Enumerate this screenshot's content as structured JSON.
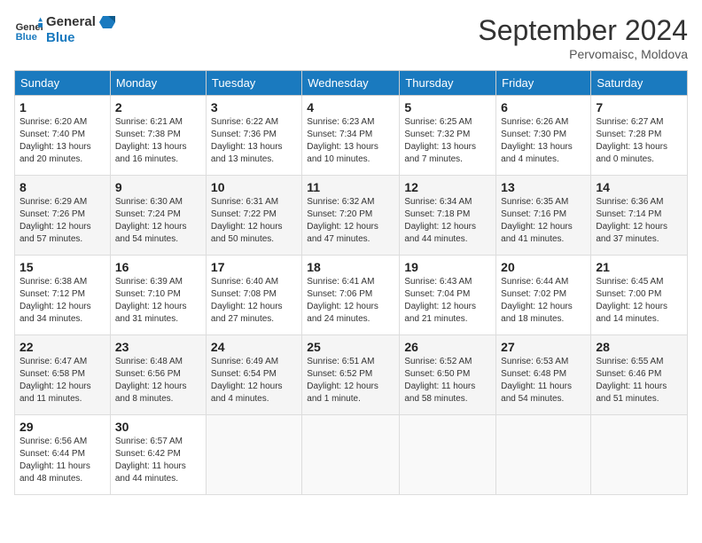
{
  "header": {
    "logo_general": "General",
    "logo_blue": "Blue",
    "month_title": "September 2024",
    "location": "Pervomaisc, Moldova"
  },
  "weekdays": [
    "Sunday",
    "Monday",
    "Tuesday",
    "Wednesday",
    "Thursday",
    "Friday",
    "Saturday"
  ],
  "weeks": [
    [
      {
        "day": "1",
        "info": "Sunrise: 6:20 AM\nSunset: 7:40 PM\nDaylight: 13 hours\nand 20 minutes."
      },
      {
        "day": "2",
        "info": "Sunrise: 6:21 AM\nSunset: 7:38 PM\nDaylight: 13 hours\nand 16 minutes."
      },
      {
        "day": "3",
        "info": "Sunrise: 6:22 AM\nSunset: 7:36 PM\nDaylight: 13 hours\nand 13 minutes."
      },
      {
        "day": "4",
        "info": "Sunrise: 6:23 AM\nSunset: 7:34 PM\nDaylight: 13 hours\nand 10 minutes."
      },
      {
        "day": "5",
        "info": "Sunrise: 6:25 AM\nSunset: 7:32 PM\nDaylight: 13 hours\nand 7 minutes."
      },
      {
        "day": "6",
        "info": "Sunrise: 6:26 AM\nSunset: 7:30 PM\nDaylight: 13 hours\nand 4 minutes."
      },
      {
        "day": "7",
        "info": "Sunrise: 6:27 AM\nSunset: 7:28 PM\nDaylight: 13 hours\nand 0 minutes."
      }
    ],
    [
      {
        "day": "8",
        "info": "Sunrise: 6:29 AM\nSunset: 7:26 PM\nDaylight: 12 hours\nand 57 minutes."
      },
      {
        "day": "9",
        "info": "Sunrise: 6:30 AM\nSunset: 7:24 PM\nDaylight: 12 hours\nand 54 minutes."
      },
      {
        "day": "10",
        "info": "Sunrise: 6:31 AM\nSunset: 7:22 PM\nDaylight: 12 hours\nand 50 minutes."
      },
      {
        "day": "11",
        "info": "Sunrise: 6:32 AM\nSunset: 7:20 PM\nDaylight: 12 hours\nand 47 minutes."
      },
      {
        "day": "12",
        "info": "Sunrise: 6:34 AM\nSunset: 7:18 PM\nDaylight: 12 hours\nand 44 minutes."
      },
      {
        "day": "13",
        "info": "Sunrise: 6:35 AM\nSunset: 7:16 PM\nDaylight: 12 hours\nand 41 minutes."
      },
      {
        "day": "14",
        "info": "Sunrise: 6:36 AM\nSunset: 7:14 PM\nDaylight: 12 hours\nand 37 minutes."
      }
    ],
    [
      {
        "day": "15",
        "info": "Sunrise: 6:38 AM\nSunset: 7:12 PM\nDaylight: 12 hours\nand 34 minutes."
      },
      {
        "day": "16",
        "info": "Sunrise: 6:39 AM\nSunset: 7:10 PM\nDaylight: 12 hours\nand 31 minutes."
      },
      {
        "day": "17",
        "info": "Sunrise: 6:40 AM\nSunset: 7:08 PM\nDaylight: 12 hours\nand 27 minutes."
      },
      {
        "day": "18",
        "info": "Sunrise: 6:41 AM\nSunset: 7:06 PM\nDaylight: 12 hours\nand 24 minutes."
      },
      {
        "day": "19",
        "info": "Sunrise: 6:43 AM\nSunset: 7:04 PM\nDaylight: 12 hours\nand 21 minutes."
      },
      {
        "day": "20",
        "info": "Sunrise: 6:44 AM\nSunset: 7:02 PM\nDaylight: 12 hours\nand 18 minutes."
      },
      {
        "day": "21",
        "info": "Sunrise: 6:45 AM\nSunset: 7:00 PM\nDaylight: 12 hours\nand 14 minutes."
      }
    ],
    [
      {
        "day": "22",
        "info": "Sunrise: 6:47 AM\nSunset: 6:58 PM\nDaylight: 12 hours\nand 11 minutes."
      },
      {
        "day": "23",
        "info": "Sunrise: 6:48 AM\nSunset: 6:56 PM\nDaylight: 12 hours\nand 8 minutes."
      },
      {
        "day": "24",
        "info": "Sunrise: 6:49 AM\nSunset: 6:54 PM\nDaylight: 12 hours\nand 4 minutes."
      },
      {
        "day": "25",
        "info": "Sunrise: 6:51 AM\nSunset: 6:52 PM\nDaylight: 12 hours\nand 1 minute."
      },
      {
        "day": "26",
        "info": "Sunrise: 6:52 AM\nSunset: 6:50 PM\nDaylight: 11 hours\nand 58 minutes."
      },
      {
        "day": "27",
        "info": "Sunrise: 6:53 AM\nSunset: 6:48 PM\nDaylight: 11 hours\nand 54 minutes."
      },
      {
        "day": "28",
        "info": "Sunrise: 6:55 AM\nSunset: 6:46 PM\nDaylight: 11 hours\nand 51 minutes."
      }
    ],
    [
      {
        "day": "29",
        "info": "Sunrise: 6:56 AM\nSunset: 6:44 PM\nDaylight: 11 hours\nand 48 minutes."
      },
      {
        "day": "30",
        "info": "Sunrise: 6:57 AM\nSunset: 6:42 PM\nDaylight: 11 hours\nand 44 minutes."
      },
      {
        "day": "",
        "info": ""
      },
      {
        "day": "",
        "info": ""
      },
      {
        "day": "",
        "info": ""
      },
      {
        "day": "",
        "info": ""
      },
      {
        "day": "",
        "info": ""
      }
    ]
  ]
}
